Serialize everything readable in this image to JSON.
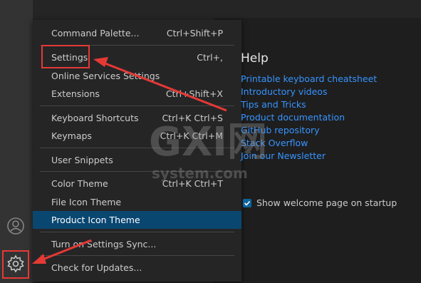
{
  "menu": {
    "items": [
      {
        "label": "Command Palette...",
        "shortcut": "Ctrl+Shift+P"
      },
      {
        "label": "Settings",
        "shortcut": "Ctrl+,"
      },
      {
        "label": "Online Services Settings",
        "shortcut": ""
      },
      {
        "label": "Extensions",
        "shortcut": "Ctrl+Shift+X"
      },
      {
        "label": "Keyboard Shortcuts",
        "shortcut": "Ctrl+K Ctrl+S"
      },
      {
        "label": "Keymaps",
        "shortcut": "Ctrl+K Ctrl+M"
      },
      {
        "label": "User Snippets",
        "shortcut": ""
      },
      {
        "label": "Color Theme",
        "shortcut": "Ctrl+K Ctrl+T"
      },
      {
        "label": "File Icon Theme",
        "shortcut": ""
      },
      {
        "label": "Product Icon Theme",
        "shortcut": "",
        "active": true
      },
      {
        "label": "Turn on Settings Sync...",
        "shortcut": ""
      },
      {
        "label": "Check for Updates...",
        "shortcut": ""
      }
    ]
  },
  "welcome": {
    "title": "Help",
    "links": [
      "Printable keyboard cheatsheet",
      "Introductory videos",
      "Tips and Tricks",
      "Product documentation",
      "GitHub repository",
      "Stack Overflow",
      "Join our Newsletter"
    ],
    "startup_label": "Show welcome page on startup",
    "startup_checked": true
  },
  "watermark": {
    "line1": "GXI网",
    "line2": "system.com"
  },
  "activity_bar": {
    "icons": [
      "account-icon",
      "gear-icon"
    ]
  },
  "colors": {
    "menu_bg": "#252526",
    "active_item": "#094771",
    "link": "#3794ff",
    "annotation": "#e53935"
  }
}
